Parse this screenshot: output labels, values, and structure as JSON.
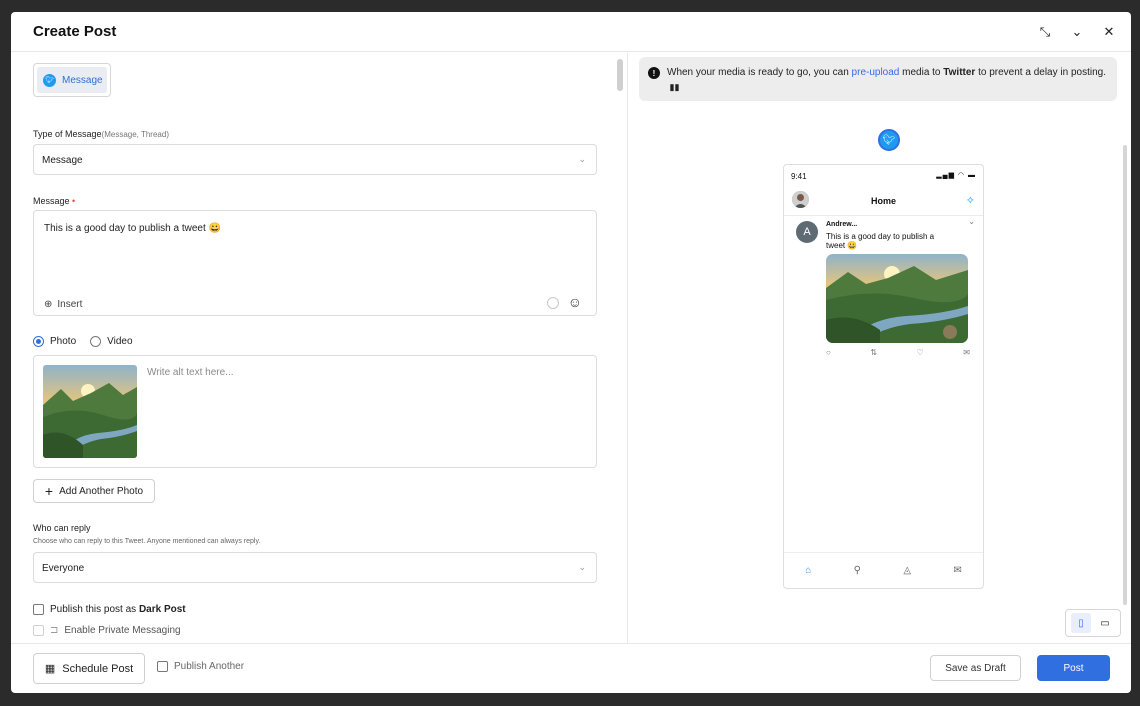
{
  "header": {
    "title": "Create Post",
    "icons": [
      "collapse-icon",
      "chevron-down-icon",
      "close-icon"
    ]
  },
  "channel": {
    "label": "Message"
  },
  "type_of_message": {
    "label": "Type of Message",
    "hint": "(Message, Thread)",
    "value": "Message"
  },
  "message": {
    "label": "Message",
    "required_mark": "•",
    "text": "This is a good day to publish a tweet 😀",
    "insert_label": "Insert"
  },
  "media": {
    "photo_label": "Photo",
    "video_label": "Video",
    "selected": "Photo",
    "alt_placeholder": "Write alt text here...",
    "add_photo_label": "Add Another Photo"
  },
  "reply": {
    "label": "Who can reply",
    "help": "Choose who can reply to this Tweet. Anyone mentioned can always reply.",
    "value": "Everyone"
  },
  "options": {
    "dark_post_prefix": "Publish this post as ",
    "dark_post_bold": "Dark Post",
    "private_messaging": "Enable Private Messaging"
  },
  "footer": {
    "schedule_label": "Schedule Post",
    "publish_another_label": "Publish Another",
    "draft_label": "Save as Draft",
    "post_label": "Post"
  },
  "info_banner": {
    "part1": "When your media is ready to go, you can ",
    "link": "pre-upload",
    "part2": " media to ",
    "bold": "Twitter",
    "part3": " to prevent a delay in posting."
  },
  "preview": {
    "time": "9:41",
    "title": "Home",
    "author_initial": "A",
    "author_name": "Andrew...",
    "tweet_text": "This is a good day to publish a tweet 😀"
  },
  "colors": {
    "accent": "#2f6fe0",
    "twitter": "#1d9bf0"
  }
}
